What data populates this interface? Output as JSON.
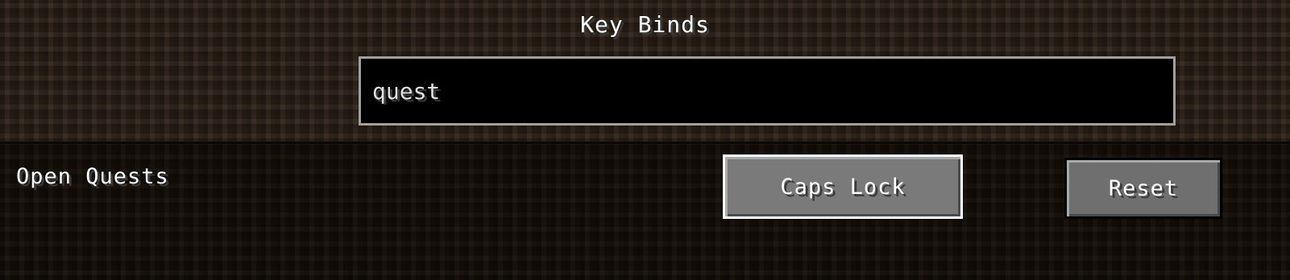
{
  "screen": {
    "title": "Key Binds"
  },
  "search": {
    "value": "quest"
  },
  "bindings": [
    {
      "action": "Open Quests",
      "key": "Caps Lock",
      "reset_label": "Reset"
    }
  ],
  "colors": {
    "search_border": "#a0a0a0",
    "button_face": "#6f6f6f",
    "button_focus_border": "#ffffff",
    "text": "#ffffff"
  }
}
